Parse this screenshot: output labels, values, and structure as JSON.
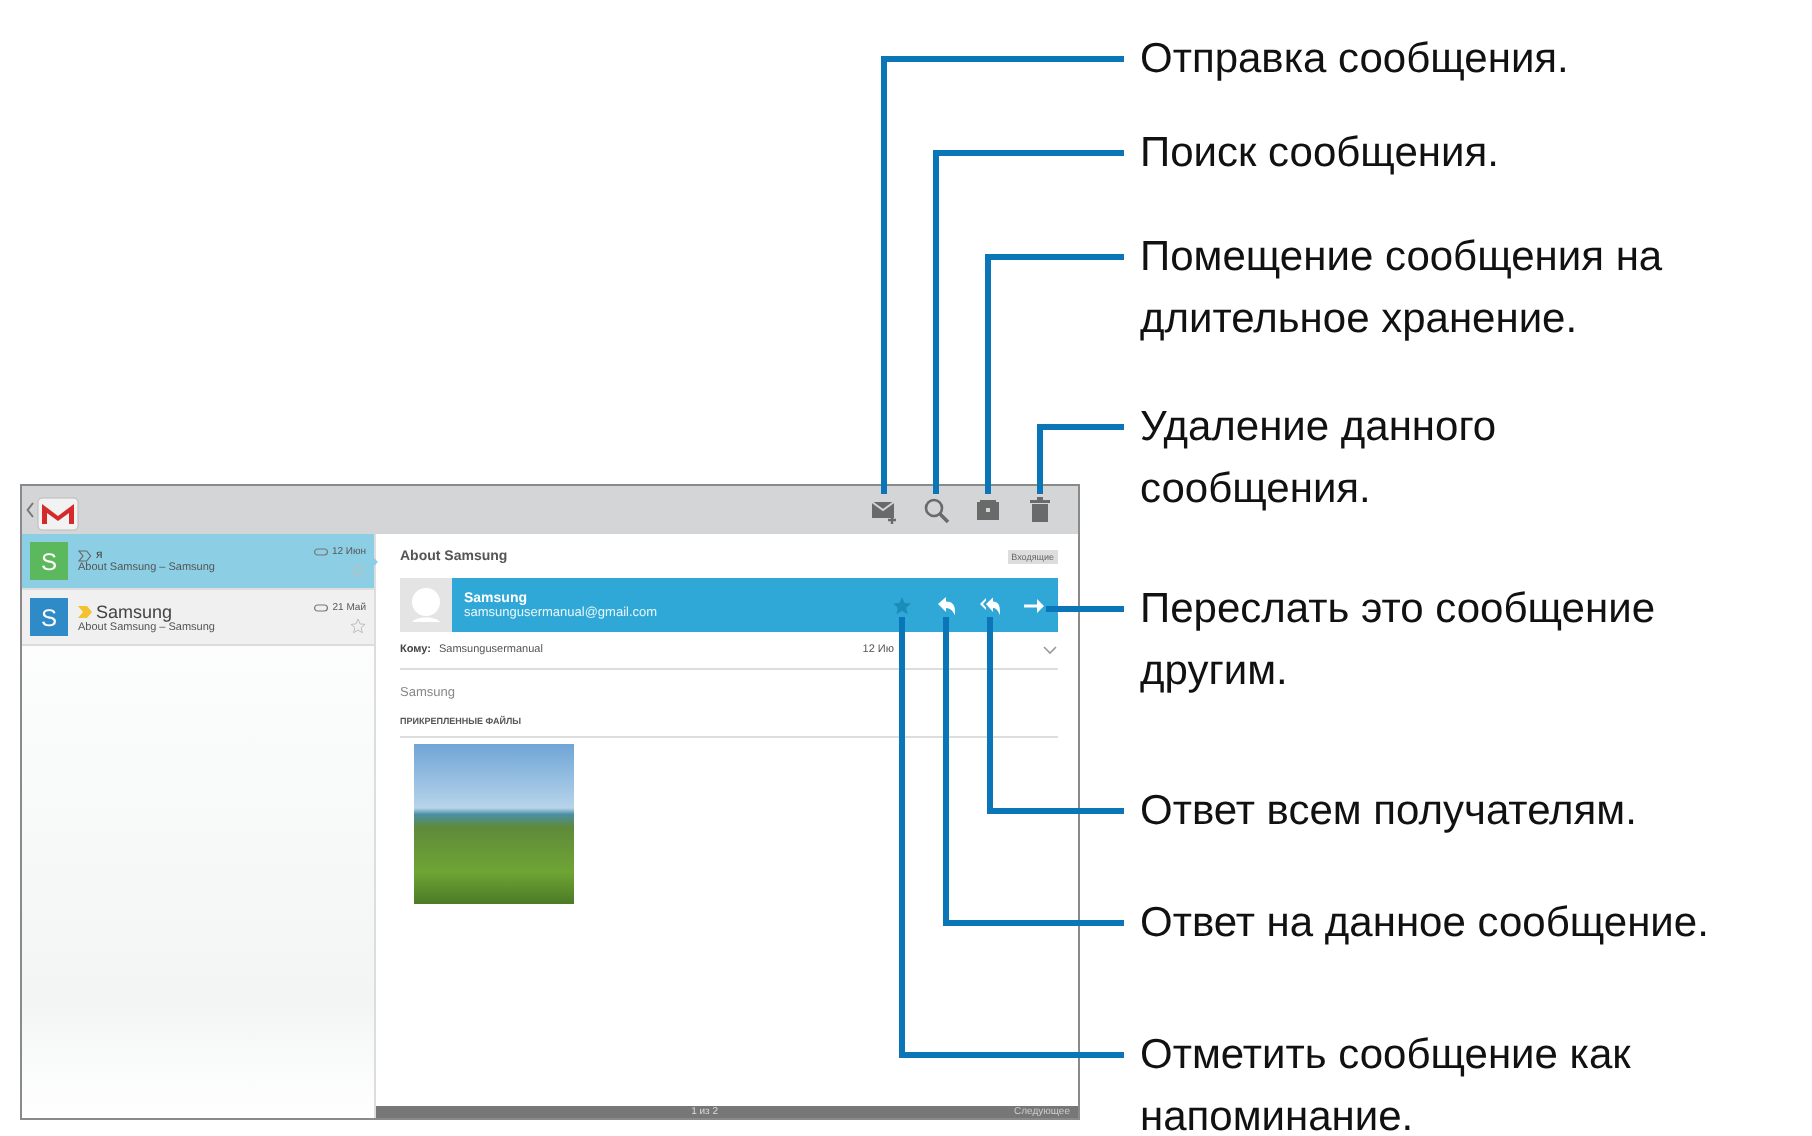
{
  "app": {
    "toolbar": {
      "actions": [
        {
          "kind": "compose"
        },
        {
          "kind": "search"
        },
        {
          "kind": "archive"
        },
        {
          "kind": "delete"
        }
      ]
    },
    "conversations": [
      {
        "initial": "S",
        "color": "#5cb85c",
        "sender": "я",
        "subject": "About Samsung – Samsung",
        "date": "12 Июн",
        "important": false,
        "selected": true
      },
      {
        "initial": "S",
        "color": "#2f8bc8",
        "sender": "Samsung",
        "subject": "About Samsung – Samsung",
        "date": "21 Май",
        "important": true,
        "selected": false
      }
    ],
    "message": {
      "title": "About Samsung",
      "label": "Входящие",
      "sender_name": "Samsung",
      "sender_email": "samsungusermanual@gmail.com",
      "actions": [
        {
          "kind": "star"
        },
        {
          "kind": "reply"
        },
        {
          "kind": "reply-all"
        },
        {
          "kind": "forward"
        }
      ],
      "to_label": "Кому:",
      "to": "Samsungusermanual",
      "date": "12 Ию",
      "body": "Samsung",
      "attachments_heading": "ПРИКРЕПЛЕННЫЕ ФАЙЛЫ"
    },
    "pager": {
      "position": "1 из 2",
      "next": "Следующее"
    }
  },
  "callouts": [
    {
      "text": "Отправка сообщения."
    },
    {
      "text": "Поиск сообщения."
    },
    {
      "text": "Помещение сообщения на длительное хранение."
    },
    {
      "text": "Удаление данного сообщения."
    },
    {
      "text": "Переслать это сообщение другим."
    },
    {
      "text": "Ответ всем получателям."
    },
    {
      "text": "Ответ на данное сообщение."
    },
    {
      "text": "Отметить сообщение как напоминание."
    }
  ]
}
